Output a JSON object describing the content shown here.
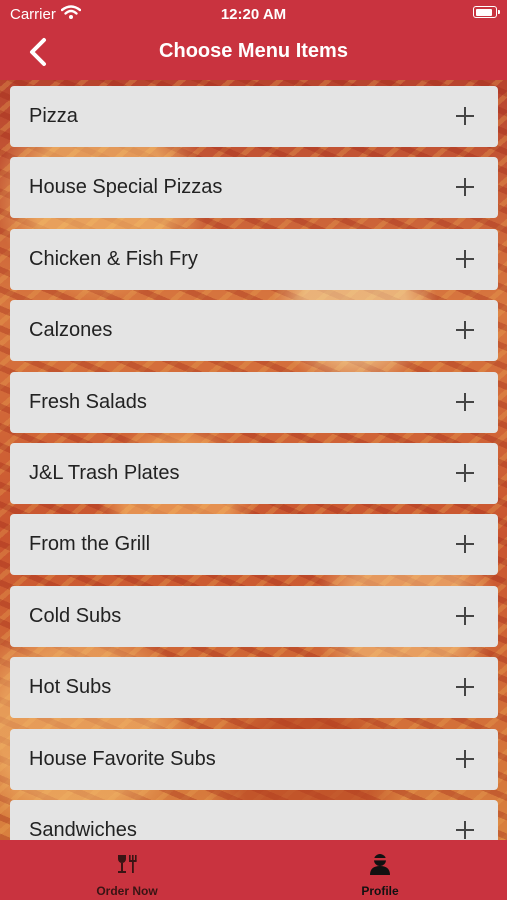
{
  "status_bar": {
    "carrier": "Carrier",
    "time": "12:20 AM",
    "battery_level": 0.9
  },
  "header": {
    "title": "Choose Menu Items",
    "back_icon": "chevron-left-icon"
  },
  "menu": {
    "items": [
      {
        "label": "Pizza"
      },
      {
        "label": "House Special Pizzas"
      },
      {
        "label": "Chicken & Fish Fry"
      },
      {
        "label": "Calzones"
      },
      {
        "label": "Fresh Salads"
      },
      {
        "label": "J&L Trash Plates"
      },
      {
        "label": "From the Grill"
      },
      {
        "label": "Cold Subs"
      },
      {
        "label": "Hot Subs"
      },
      {
        "label": "House Favorite Subs"
      },
      {
        "label": "Sandwiches"
      }
    ],
    "expand_icon": "plus-icon"
  },
  "tab_bar": {
    "tabs": [
      {
        "label": "Order Now",
        "icon": "fork-glass-icon",
        "active": false
      },
      {
        "label": "Profile",
        "icon": "user-icon",
        "active": true
      }
    ]
  },
  "colors": {
    "brand": "#c9333f",
    "row_bg": "#e4e4e4",
    "text": "#222222"
  }
}
